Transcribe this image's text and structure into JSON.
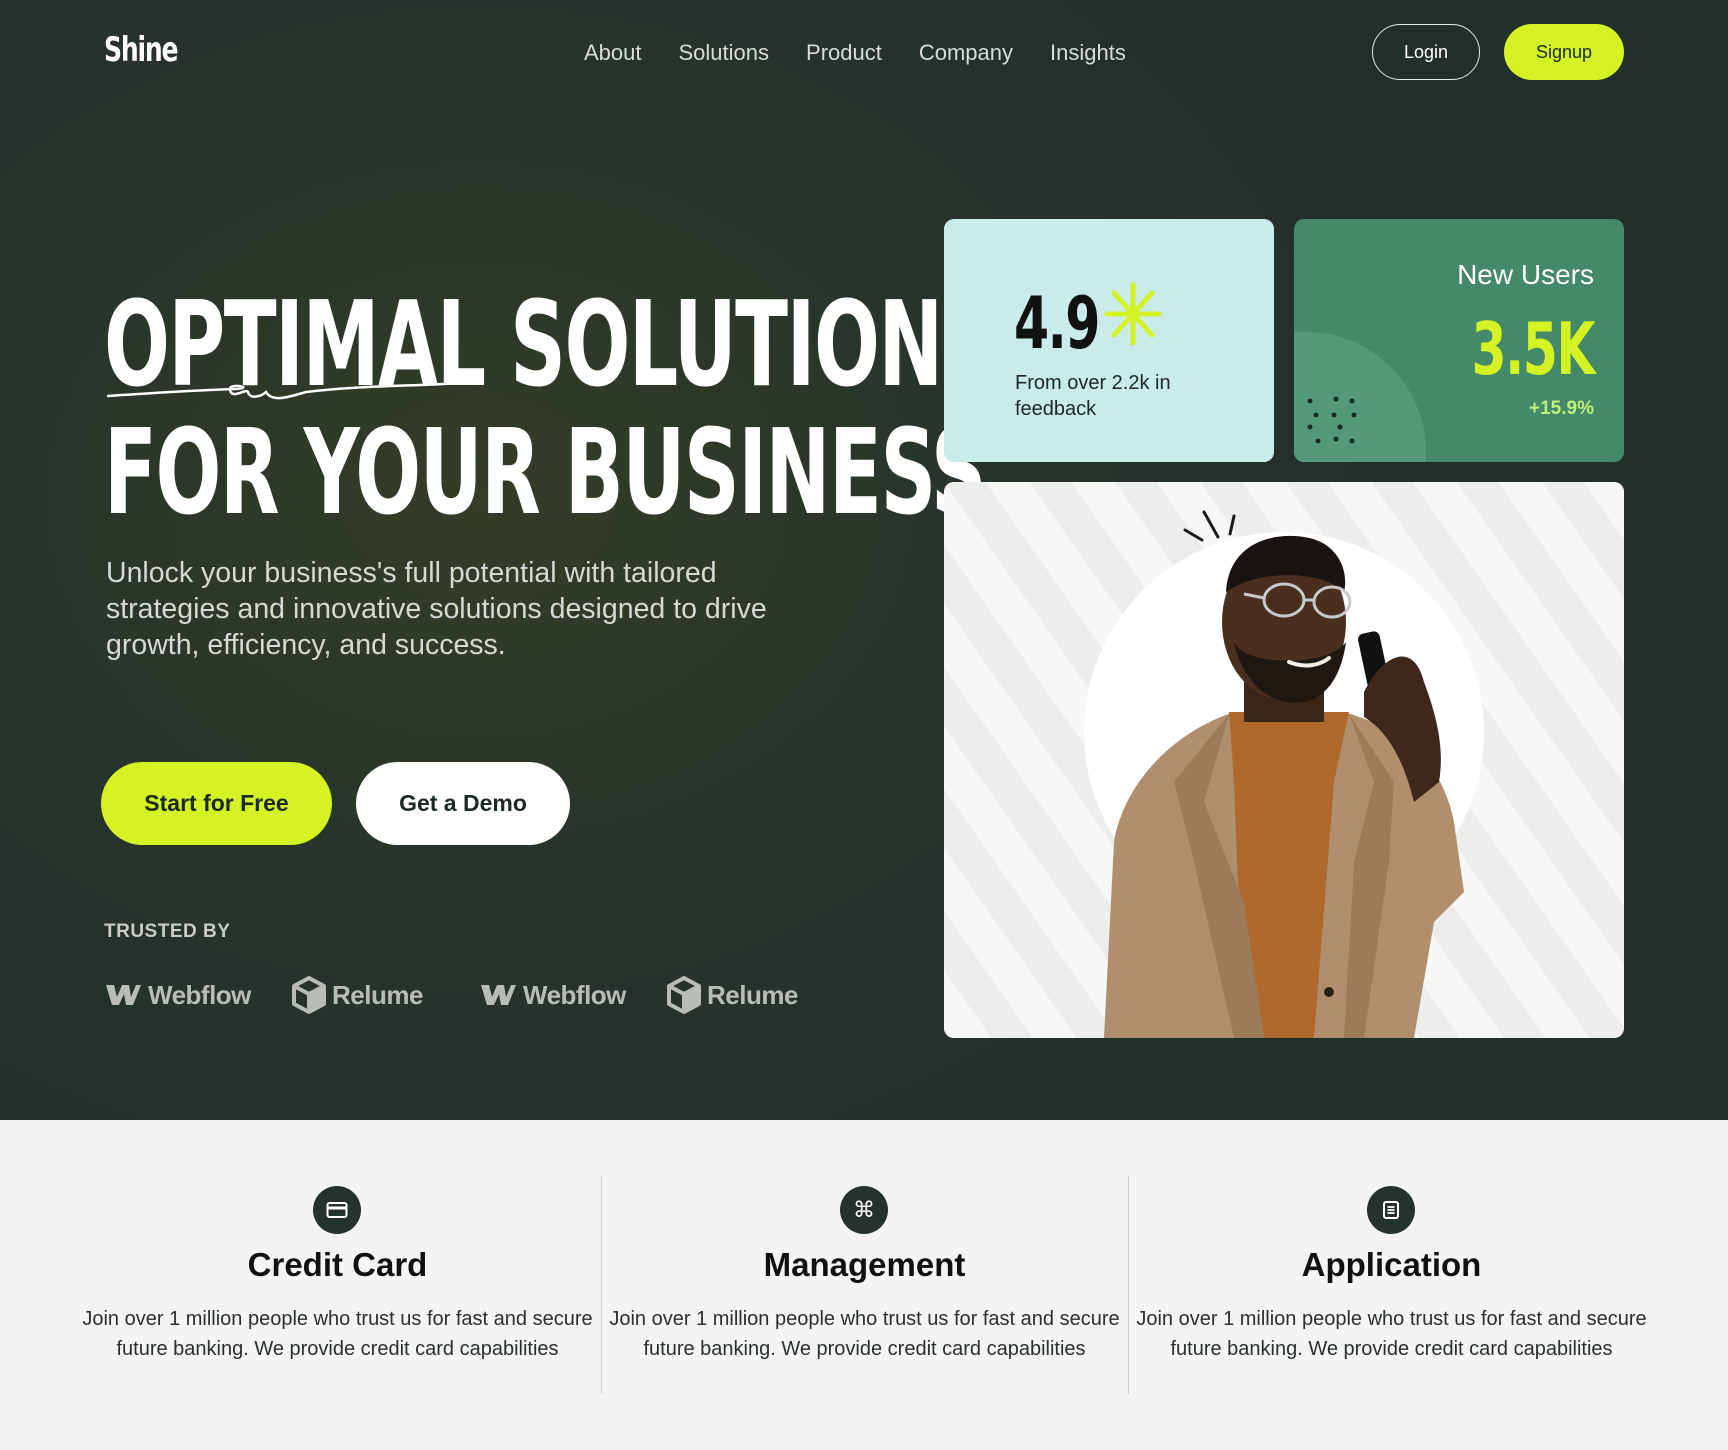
{
  "brand": {
    "logo": "Shine"
  },
  "nav": {
    "items": [
      "About",
      "Solutions",
      "Product",
      "Company",
      "Insights"
    ]
  },
  "auth": {
    "login": "Login",
    "signup": "Signup"
  },
  "hero": {
    "headline_line1": "OPTIMAL SOLUTION",
    "headline_line2": "FOR YOUR BUSINESS",
    "subtext": "Unlock your business's full potential with tailored strategies and innovative solutions designed to drive growth, efficiency, and success.",
    "cta_primary": "Start for Free",
    "cta_secondary": "Get a Demo",
    "trusted_label": "TRUSTED BY",
    "trusted_logos": [
      "Webflow",
      "Relume",
      "Webflow",
      "Relume"
    ]
  },
  "rating_card": {
    "value": "4.9",
    "caption": "From over 2.2k in feedback"
  },
  "users_card": {
    "title": "New Users",
    "value": "3.5K",
    "delta": "+15.9%"
  },
  "features": [
    {
      "icon": "credit-card-icon",
      "title": "Credit Card",
      "desc": "Join over 1 million people who trust us for fast and secure future banking. We provide credit card capabilities"
    },
    {
      "icon": "command-icon",
      "title": "Management",
      "desc": "Join over 1 million people who trust us for fast and secure future banking. We provide credit card capabilities"
    },
    {
      "icon": "document-icon",
      "title": "Application",
      "desc": "Join over 1 million people who trust us for fast and secure future banking. We provide credit card capabilities"
    }
  ],
  "colors": {
    "accent": "#d4f224",
    "hero_bg": "#27322c",
    "rating_card": "#c9ebea",
    "users_card": "#43896a"
  }
}
